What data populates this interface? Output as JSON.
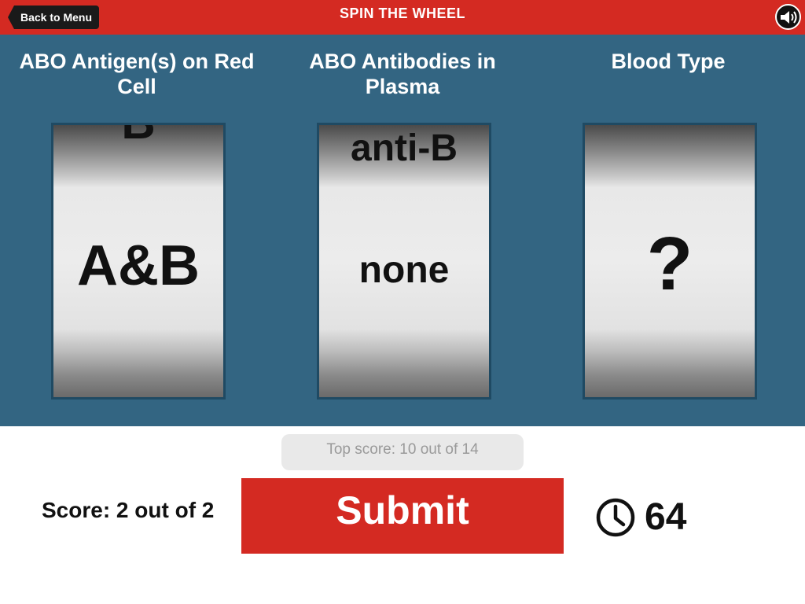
{
  "header": {
    "back_label": "Back to Menu",
    "title": "SPIN THE WHEEL",
    "sound_icon": "speaker-icon",
    "bar_color": "#d42a22"
  },
  "columns": [
    {
      "heading": "ABO Antigen(s) on Red Cell",
      "above_value": "B",
      "value": "A&B"
    },
    {
      "heading": "ABO Antibodies in Plasma",
      "above_value": "anti-B",
      "value": "none"
    },
    {
      "heading": "Blood Type",
      "above_value": "",
      "value": "?"
    }
  ],
  "footer": {
    "top_score": "Top score: 10 out of 14",
    "score": "Score: 2 out of 2",
    "submit_label": "Submit",
    "timer_icon": "clock-icon",
    "timer_value": "64"
  },
  "colors": {
    "stage_bg": "#336582",
    "accent": "#d42a22"
  }
}
